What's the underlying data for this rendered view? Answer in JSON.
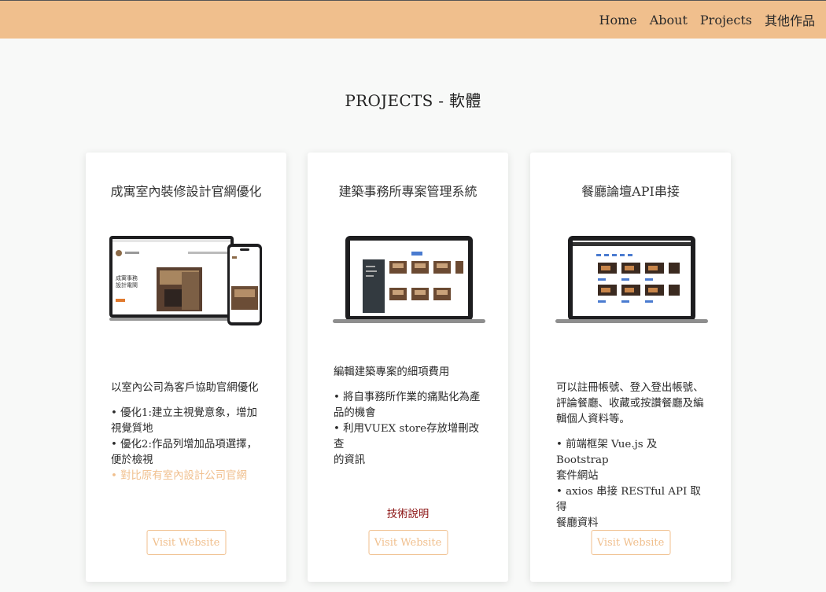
{
  "nav": {
    "items": [
      "Home",
      "About",
      "Projects",
      "其他作品"
    ]
  },
  "page_title": "PROJECTS - 軟體",
  "cards": [
    {
      "title": "成寓室內裝修設計官網優化",
      "description": "以室內公司為客戶協助官網優化",
      "bullets": [
        "• 優化1:建立主視覺意象，增加",
        "視覺質地",
        "• 優化2:作品列增加品項選擇，",
        "便於檢視"
      ],
      "link": "• 對比原有室內設計公司官網",
      "mockup_text": "成寓事務設計電鬧",
      "button": "Visit Website"
    },
    {
      "title": "建築事務所專案管理系統",
      "description": "編輯建築專案的細項費用",
      "bullets": [
        "• 將自事務所作業的痛點化為產",
        "品的機會",
        "• 利用VUEX store存放增刪改查",
        "的資訊"
      ],
      "tech_link": "技術說明",
      "button": "Visit Website"
    },
    {
      "title": "餐廳論壇API串接",
      "description_lines": [
        "可以註冊帳號、登入登出帳號、",
        "評論餐廳、收藏或按讚餐廳及編",
        "輯個人資料等。"
      ],
      "bullets": [
        "• 前端框架 Vue.js 及 Bootstrap",
        "套件網站",
        "• axios 串接 RESTful API 取得",
        "餐廳資料"
      ],
      "button": "Visit Website"
    }
  ],
  "colors": {
    "navbar": "#f0bf8d",
    "accent": "#f0bf8d",
    "tech_link": "#8a1010",
    "background": "#f8f9f8"
  }
}
